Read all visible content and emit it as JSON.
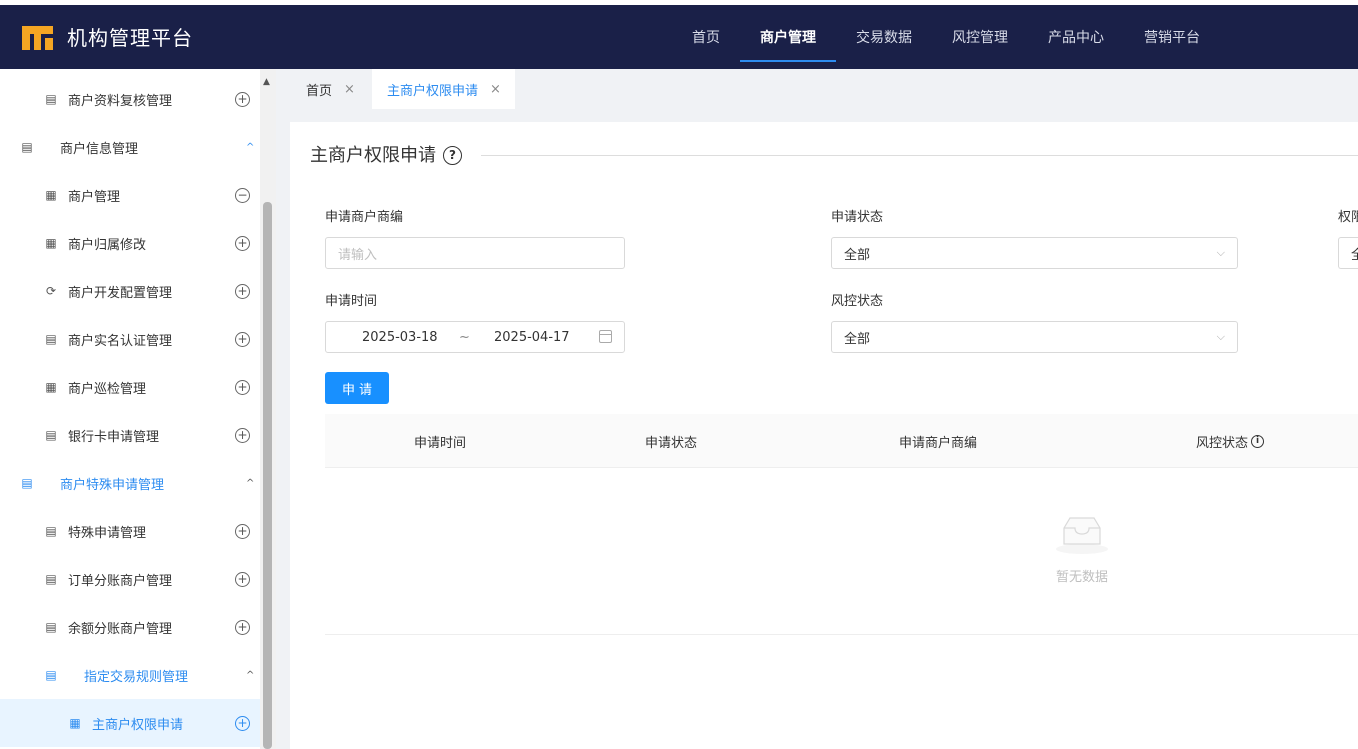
{
  "app": {
    "title": "机构管理平台"
  },
  "topnav": [
    {
      "label": "首页"
    },
    {
      "label": "商户管理"
    },
    {
      "label": "交易数据"
    },
    {
      "label": "风控管理"
    },
    {
      "label": "产品中心"
    },
    {
      "label": "营销平台"
    }
  ],
  "sidebar": {
    "items": [
      {
        "label": "商户资料复核管理",
        "toggle": "+"
      },
      {
        "label": "商户信息管理"
      },
      {
        "label": "商户管理",
        "toggle": "−"
      },
      {
        "label": "商户归属修改",
        "toggle": "+"
      },
      {
        "label": "商户开发配置管理",
        "toggle": "+"
      },
      {
        "label": "商户实名认证管理",
        "toggle": "+"
      },
      {
        "label": "商户巡检管理",
        "toggle": "+"
      },
      {
        "label": "银行卡申请管理",
        "toggle": "+"
      },
      {
        "label": "商户特殊申请管理"
      },
      {
        "label": "特殊申请管理",
        "toggle": "+"
      },
      {
        "label": "订单分账商户管理",
        "toggle": "+"
      },
      {
        "label": "余额分账商户管理",
        "toggle": "+"
      },
      {
        "label": "指定交易规则管理"
      },
      {
        "label": "主商户权限申请",
        "toggle": "+"
      }
    ]
  },
  "tabs": [
    {
      "label": "首页",
      "close": "×"
    },
    {
      "label": "主商户权限申请",
      "close": "×"
    }
  ],
  "page": {
    "title": "主商户权限申请",
    "help": "?"
  },
  "form": {
    "merchant_no_label": "申请商户商编",
    "merchant_no_placeholder": "请输入",
    "apply_status_label": "申请状态",
    "apply_status_value": "全部",
    "third_label": "权限",
    "third_value": "全部",
    "apply_time_label": "申请时间",
    "date_start": "2025-03-18",
    "date_sep": "~",
    "date_end": "2025-04-17",
    "risk_status_label": "风控状态",
    "risk_status_value": "全部",
    "submit_label": "申请"
  },
  "table": {
    "columns": [
      "申请时间",
      "申请状态",
      "申请商户商编",
      "风控状态"
    ],
    "info": "i",
    "empty_text": "暂无数据"
  }
}
